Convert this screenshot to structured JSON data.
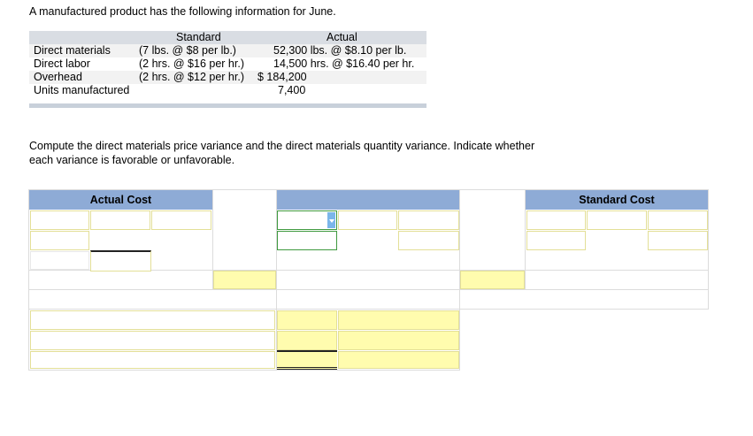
{
  "intro": "A manufactured product has the following information for June.",
  "info_table": {
    "col_standard": "Standard",
    "col_actual": "Actual",
    "rows": [
      {
        "label": "Direct materials",
        "standard": "(7 lbs. @ $8 per lb.)",
        "actual": "52,300 lbs. @ $8.10 per lb."
      },
      {
        "label": "Direct labor",
        "standard": "(2 hrs. @ $16 per hr.)",
        "actual": "14,500 hrs. @ $16.40 per hr."
      },
      {
        "label": "Overhead",
        "standard": "(2 hrs. @ $12 per hr.)",
        "actual": "$ 184,200"
      },
      {
        "label": "Units manufactured",
        "standard": "",
        "actual": "7,400"
      }
    ]
  },
  "instructions": {
    "line1": "Compute the direct materials price variance and  the direct materials quantity variance. Indicate whether",
    "line2": "each variance is favorable or unfavorable."
  },
  "worksheet": {
    "actual_cost_label": "Actual Cost",
    "standard_cost_label": "Standard Cost",
    "colors": {
      "header": "#8eabd6",
      "input_border": "#e3df97",
      "input_fill": "#fffcae",
      "dropdown_border": "#3f9a3f",
      "dropdown_arrow": "#7bb6ea"
    }
  }
}
